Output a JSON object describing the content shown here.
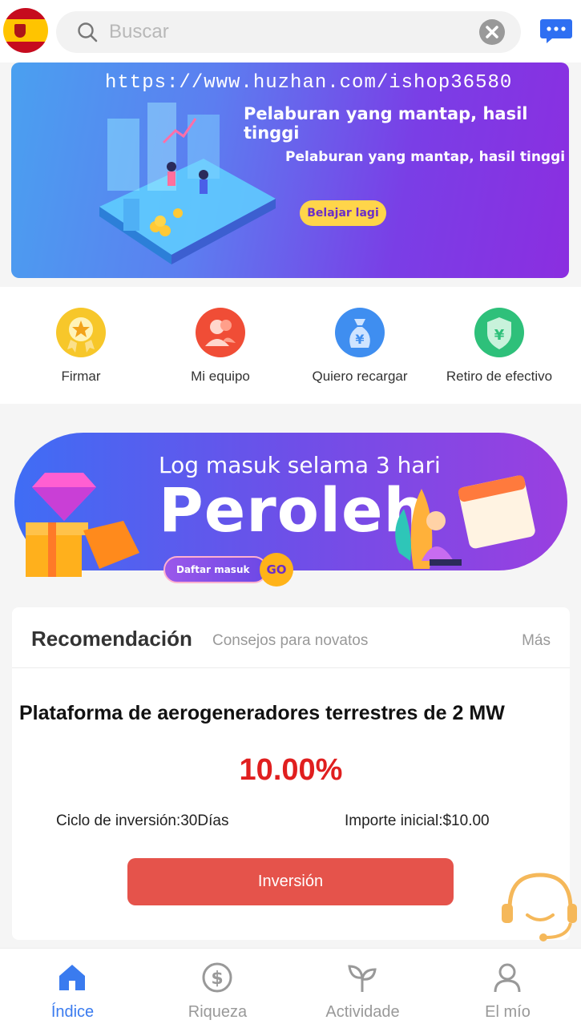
{
  "header": {
    "flag_icon": "spain-flag-icon",
    "search_placeholder": "Buscar",
    "chat_icon": "message-icon"
  },
  "hero": {
    "url_text": "https://www.huzhan.com/ishop36580",
    "headline": "Pelaburan yang mantap, hasil tinggi",
    "subline": "Pelaburan yang mantap, hasil tinggi",
    "button_label": "Belajar lagi"
  },
  "quick_actions": [
    {
      "label": "Firmar",
      "icon": "star-medal-icon",
      "color": "#f7c72a"
    },
    {
      "label": "Mi equipo",
      "icon": "team-icon",
      "color": "#f04d36"
    },
    {
      "label": "Quiero recargar",
      "icon": "money-bag-icon",
      "color": "#3f8ef0"
    },
    {
      "label": "Retiro de efectivo",
      "icon": "shield-yen-icon",
      "color": "#2ec07a"
    }
  ],
  "promo": {
    "line1": "Log masuk selama 3 hari",
    "line2": "Peroleh",
    "daftar_label": "Daftar masuk",
    "go_label": "GO"
  },
  "recommendation": {
    "title": "Recomendación",
    "subtitle": "Consejos para novatos",
    "more_label": "Más",
    "product_name": "Plataforma de aerogeneradores terrestres de 2 MW",
    "rate": "10.00%",
    "cycle": "Ciclo de inversión:30Días",
    "amount": "Importe inicial:$10.00",
    "invest_label": "Inversión"
  },
  "bottom_nav": [
    {
      "label": "Índice",
      "icon": "home-icon",
      "active": true
    },
    {
      "label": "Riqueza",
      "icon": "dollar-icon",
      "active": false
    },
    {
      "label": "Actividade",
      "icon": "sprout-icon",
      "active": false
    },
    {
      "label": "El mío",
      "icon": "user-icon",
      "active": false
    }
  ],
  "colors": {
    "accent": "#3a7bef",
    "rate_red": "#e01f1f",
    "invest_button": "#e5534b",
    "hero_purple": "#7a3ee6"
  }
}
